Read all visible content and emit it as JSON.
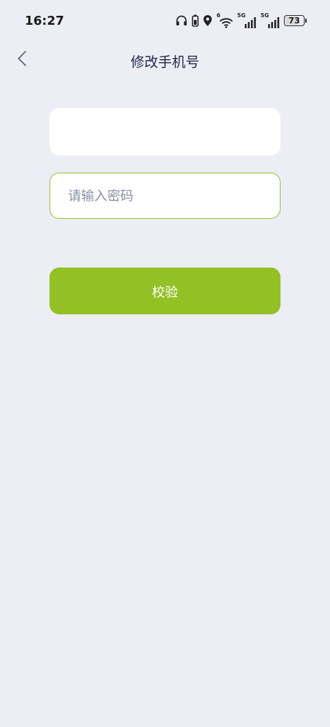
{
  "status_bar": {
    "time": "16:27",
    "icons": [
      "headphones-icon",
      "battery-saver-icon",
      "location-icon",
      "wifi-icon",
      "signal-icon",
      "signal-icon"
    ],
    "wifi_badge": "6",
    "sim1_label": "5G",
    "sim2_label": "5G",
    "battery_level": "73"
  },
  "nav": {
    "back_icon": "chevron-left-icon",
    "title": "修改手机号"
  },
  "form": {
    "phone_value": "",
    "password_placeholder": "请输入密码",
    "password_value": "",
    "verify_label": "校验"
  },
  "colors": {
    "background": "#ecedf5",
    "accent": "#93c025",
    "input_border_active": "#8fc12a",
    "title_text": "#1f2a44",
    "placeholder_text": "#8a8fa6"
  }
}
